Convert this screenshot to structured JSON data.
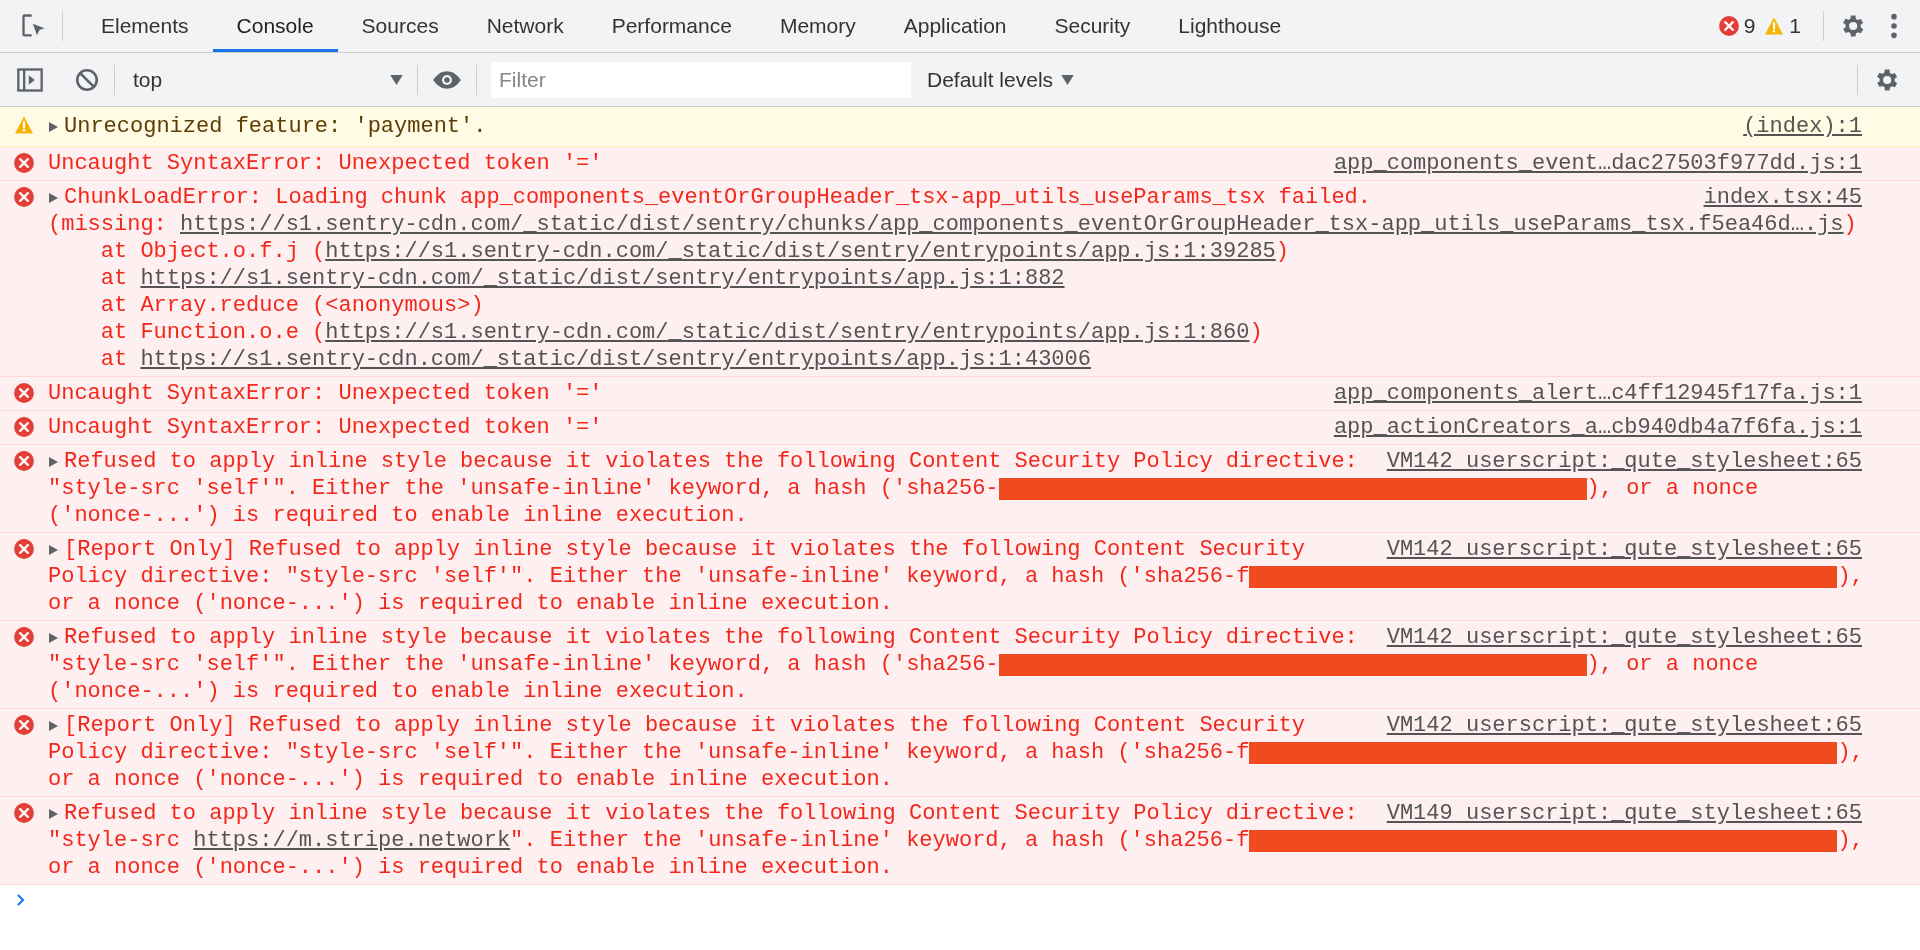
{
  "tabs": [
    {
      "label": "Elements",
      "selected": false
    },
    {
      "label": "Console",
      "selected": true
    },
    {
      "label": "Sources",
      "selected": false
    },
    {
      "label": "Network",
      "selected": false
    },
    {
      "label": "Performance",
      "selected": false
    },
    {
      "label": "Memory",
      "selected": false
    },
    {
      "label": "Application",
      "selected": false
    },
    {
      "label": "Security",
      "selected": false
    },
    {
      "label": "Lighthouse",
      "selected": false
    }
  ],
  "issue_counts": {
    "errors": "9",
    "warnings": "1"
  },
  "console_toolbar": {
    "context": "top",
    "filter": {
      "placeholder": "Filter"
    },
    "levels": "Default levels"
  },
  "messages": [
    {
      "kind": "warning",
      "expanded": false,
      "source": "(index):1",
      "lines": [
        {
          "kind": "text",
          "segments": [
            {
              "kind": "text",
              "text": "Unrecognized feature: 'payment'."
            }
          ]
        }
      ]
    },
    {
      "kind": "error",
      "source": "app_components_event…dac27503f977dd.js:1",
      "lines": [
        {
          "kind": "text",
          "segments": [
            {
              "kind": "text",
              "text": "Uncaught SyntaxError: Unexpected token '='"
            }
          ]
        }
      ]
    },
    {
      "kind": "error",
      "expanded": false,
      "source": "index.tsx:45",
      "lines": [
        {
          "kind": "text",
          "segments": [
            {
              "kind": "text",
              "text": "ChunkLoadError: Loading chunk app_components_eventOrGroupHeader_tsx-app_utils_useParams_tsx failed."
            }
          ]
        },
        {
          "kind": "text",
          "segments": [
            {
              "kind": "text",
              "text": "(missing: "
            },
            {
              "kind": "link",
              "text": "https://s1.sentry-cdn.com/_static/dist/sentry/chunks/app_components_eventOrGroupHeader_tsx-app_utils_useParams_tsx.f5ea46d….js"
            },
            {
              "kind": "text",
              "text": ")"
            }
          ]
        },
        {
          "kind": "frame",
          "segments": [
            {
              "kind": "text",
              "text": "at Object.o.f.j ("
            },
            {
              "kind": "link",
              "text": "https://s1.sentry-cdn.com/_static/dist/sentry/entrypoints/app.js:1:39285"
            },
            {
              "kind": "text",
              "text": ")"
            }
          ]
        },
        {
          "kind": "frame",
          "segments": [
            {
              "kind": "text",
              "text": "at "
            },
            {
              "kind": "link",
              "text": "https://s1.sentry-cdn.com/_static/dist/sentry/entrypoints/app.js:1:882"
            }
          ]
        },
        {
          "kind": "frame",
          "segments": [
            {
              "kind": "text",
              "text": "at Array.reduce (<anonymous>)"
            }
          ]
        },
        {
          "kind": "frame",
          "segments": [
            {
              "kind": "text",
              "text": "at Function.o.e ("
            },
            {
              "kind": "link",
              "text": "https://s1.sentry-cdn.com/_static/dist/sentry/entrypoints/app.js:1:860"
            },
            {
              "kind": "text",
              "text": ")"
            }
          ]
        },
        {
          "kind": "frame",
          "segments": [
            {
              "kind": "text",
              "text": "at "
            },
            {
              "kind": "link",
              "text": "https://s1.sentry-cdn.com/_static/dist/sentry/entrypoints/app.js:1:43006"
            }
          ]
        }
      ]
    },
    {
      "kind": "error",
      "source": "app_components_alert…c4ff12945f17fa.js:1",
      "lines": [
        {
          "kind": "text",
          "segments": [
            {
              "kind": "text",
              "text": "Uncaught SyntaxError: Unexpected token '='"
            }
          ]
        }
      ]
    },
    {
      "kind": "error",
      "source": "app_actionCreators_a…cb940db4a7f6fa.js:1",
      "lines": [
        {
          "kind": "text",
          "segments": [
            {
              "kind": "text",
              "text": "Uncaught SyntaxError: Unexpected token '='"
            }
          ]
        }
      ]
    },
    {
      "kind": "error",
      "expanded": false,
      "source": "VM142 userscript:_qute_stylesheet:65",
      "lines": [
        {
          "kind": "text",
          "segments": [
            {
              "kind": "text",
              "text": "Refused to apply inline style because it violates the following Content Security Policy directive:"
            }
          ]
        },
        {
          "kind": "text",
          "segments": [
            {
              "kind": "text",
              "text": "\"style-src 'self'\". Either the 'unsafe-inline' keyword, a hash ('sha256-"
            },
            {
              "kind": "redacted"
            },
            {
              "kind": "text",
              "text": "), or a nonce"
            }
          ]
        },
        {
          "kind": "text",
          "segments": [
            {
              "kind": "text",
              "text": "('nonce-...') is required to enable inline execution."
            }
          ]
        }
      ]
    },
    {
      "kind": "error",
      "expanded": false,
      "source": "VM142 userscript:_qute_stylesheet:65",
      "lines": [
        {
          "kind": "text",
          "segments": [
            {
              "kind": "text",
              "text": "[Report Only] Refused to apply inline style because it violates the following Content Security"
            }
          ]
        },
        {
          "kind": "text",
          "segments": [
            {
              "kind": "text",
              "text": "Policy directive: \"style-src 'self'\". Either the 'unsafe-inline' keyword, a hash ('sha256-f"
            },
            {
              "kind": "redacted"
            },
            {
              "kind": "text",
              "text": "),"
            }
          ]
        },
        {
          "kind": "text",
          "segments": [
            {
              "kind": "text",
              "text": "or a nonce ('nonce-...') is required to enable inline execution."
            }
          ]
        }
      ]
    },
    {
      "kind": "error",
      "expanded": false,
      "source": "VM142 userscript:_qute_stylesheet:65",
      "lines": [
        {
          "kind": "text",
          "segments": [
            {
              "kind": "text",
              "text": "Refused to apply inline style because it violates the following Content Security Policy directive:"
            }
          ]
        },
        {
          "kind": "text",
          "segments": [
            {
              "kind": "text",
              "text": "\"style-src 'self'\". Either the 'unsafe-inline' keyword, a hash ('sha256-"
            },
            {
              "kind": "redacted"
            },
            {
              "kind": "text",
              "text": "), or a nonce"
            }
          ]
        },
        {
          "kind": "text",
          "segments": [
            {
              "kind": "text",
              "text": "('nonce-...') is required to enable inline execution."
            }
          ]
        }
      ]
    },
    {
      "kind": "error",
      "expanded": false,
      "source": "VM142 userscript:_qute_stylesheet:65",
      "lines": [
        {
          "kind": "text",
          "segments": [
            {
              "kind": "text",
              "text": "[Report Only] Refused to apply inline style because it violates the following Content Security"
            }
          ]
        },
        {
          "kind": "text",
          "segments": [
            {
              "kind": "text",
              "text": "Policy directive: \"style-src 'self'\". Either the 'unsafe-inline' keyword, a hash ('sha256-f"
            },
            {
              "kind": "redacted"
            },
            {
              "kind": "text",
              "text": "),"
            }
          ]
        },
        {
          "kind": "text",
          "segments": [
            {
              "kind": "text",
              "text": "or a nonce ('nonce-...') is required to enable inline execution."
            }
          ]
        }
      ]
    },
    {
      "kind": "error",
      "expanded": false,
      "source": "VM149 userscript:_qute_stylesheet:65",
      "lines": [
        {
          "kind": "text",
          "segments": [
            {
              "kind": "text",
              "text": "Refused to apply inline style because it violates the following Content Security Policy directive:"
            }
          ]
        },
        {
          "kind": "text",
          "segments": [
            {
              "kind": "text",
              "text": "\"style-src "
            },
            {
              "kind": "link",
              "text": "https://m.stripe.network"
            },
            {
              "kind": "text",
              "text": "\". Either the 'unsafe-inline' keyword, a hash ('sha256-f"
            },
            {
              "kind": "redacted"
            },
            {
              "kind": "text",
              "text": "),"
            }
          ]
        },
        {
          "kind": "text",
          "segments": [
            {
              "kind": "text",
              "text": "or a nonce ('nonce-...') is required to enable inline execution."
            }
          ]
        }
      ]
    }
  ]
}
